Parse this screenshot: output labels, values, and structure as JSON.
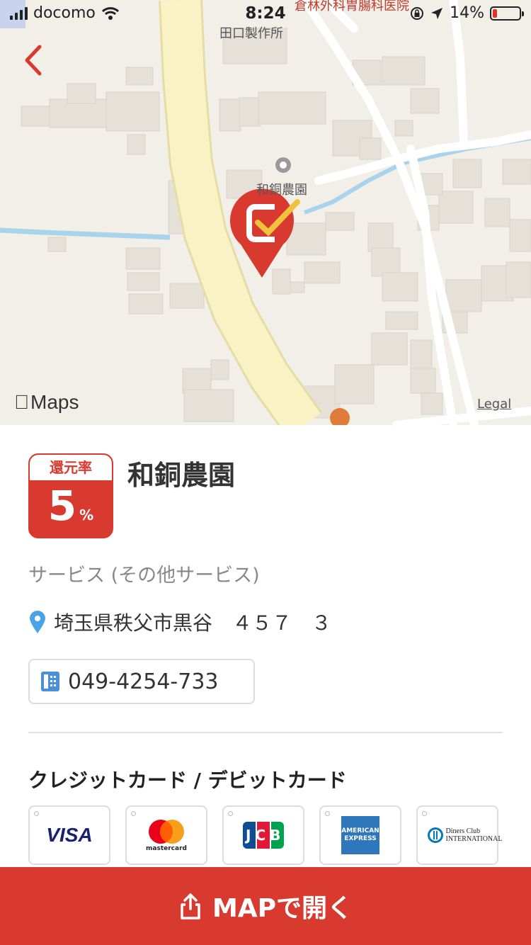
{
  "status_bar": {
    "carrier": "docomo",
    "time": "8:24",
    "battery": "14%"
  },
  "map": {
    "labels": {
      "hospital": "倉林外科胃腸科医院",
      "factory": "田口製作所",
      "store": "和銅農園"
    },
    "attribution": "Maps",
    "legal": "Legal"
  },
  "shop": {
    "rate_label": "還元率",
    "rate_value": "5",
    "rate_unit": "%",
    "name": "和銅農園",
    "category": "サービス (その他サービス)",
    "address": "埼玉県秩父市黒谷　４５７　３",
    "phone": "049-4254-733"
  },
  "payments": {
    "title": "クレジットカード / デビットカード",
    "cards": [
      "VISA",
      "mastercard",
      "JCB",
      "AMERICAN EXPRESS",
      "Diners Club INTERNATIONAL"
    ]
  },
  "actions": {
    "open_map": "MAPで開く"
  },
  "colors": {
    "accent": "#d93a2f",
    "map_bg": "#f2efe9",
    "road_main": "#f8f2c4",
    "water": "#a9d3ec"
  }
}
